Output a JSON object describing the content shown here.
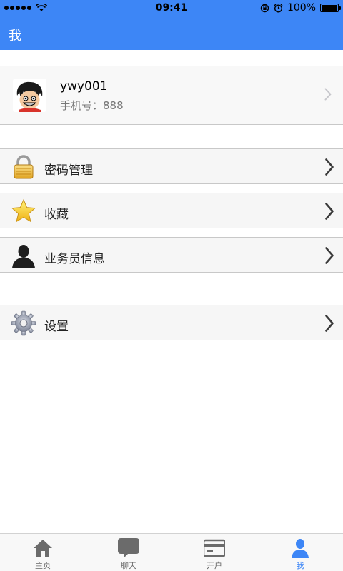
{
  "status_bar": {
    "time": "09:41",
    "battery": "100%"
  },
  "header": {
    "title": "我"
  },
  "profile": {
    "username": "ywy001",
    "phone": "手机号：888"
  },
  "menu": [
    {
      "label": "密码管理",
      "icon": "lock-icon"
    },
    {
      "label": "收藏",
      "icon": "star-icon"
    },
    {
      "label": "业务员信息",
      "icon": "person-icon"
    },
    {
      "label": "设置",
      "icon": "gear-icon"
    }
  ],
  "tabs": [
    {
      "label": "主页",
      "icon": "home-icon",
      "active": false
    },
    {
      "label": "聊天",
      "icon": "chat-icon",
      "active": false
    },
    {
      "label": "开户",
      "icon": "card-icon",
      "active": false
    },
    {
      "label": "我",
      "icon": "user-icon",
      "active": true
    }
  ],
  "colors": {
    "accent": "#3d86f6",
    "tab_inactive": "#666666"
  }
}
